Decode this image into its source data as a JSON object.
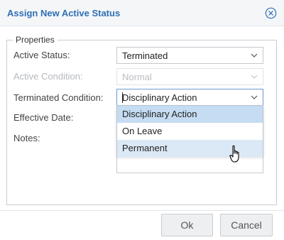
{
  "dialog": {
    "title": "Assign New Active Status",
    "close_icon": "close-circle-icon"
  },
  "fieldset": {
    "legend": "Properties"
  },
  "fields": {
    "active_status": {
      "label": "Active Status:",
      "value": "Terminated"
    },
    "active_condition": {
      "label": "Active Condition:",
      "value": "Normal",
      "disabled": true
    },
    "terminated_condition": {
      "label": "Terminated Condition:",
      "value": "Disciplinary Action"
    },
    "effective_date": {
      "label": "Effective Date:",
      "value": ""
    },
    "notes": {
      "label": "Notes:",
      "value": ""
    }
  },
  "dropdown": {
    "options": [
      "Disciplinary Action",
      "On Leave",
      "Permanent"
    ],
    "selected": "Disciplinary Action",
    "hovered": "Permanent"
  },
  "buttons": {
    "ok": "Ok",
    "cancel": "Cancel"
  },
  "colors": {
    "title": "#2f6fb5",
    "selected_option": "#c5dcf2",
    "hovered_option": "#dbe8f6"
  }
}
